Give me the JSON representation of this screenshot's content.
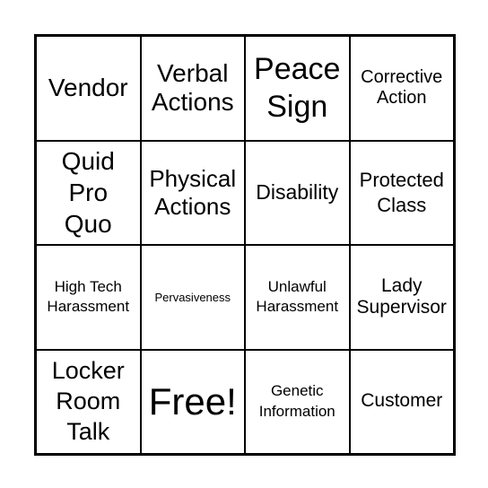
{
  "card": {
    "cells": [
      "Vendor",
      "Verbal Actions",
      "Peace Sign",
      "Corrective Action",
      "Quid Pro Quo",
      "Physical Actions",
      "Disability",
      "Protected Class",
      "High Tech Harassment",
      "Pervasiveness",
      "Unlawful Harassment",
      "Lady Supervisor",
      "Locker Room Talk",
      "Free!",
      "Genetic Information",
      "Customer"
    ]
  }
}
